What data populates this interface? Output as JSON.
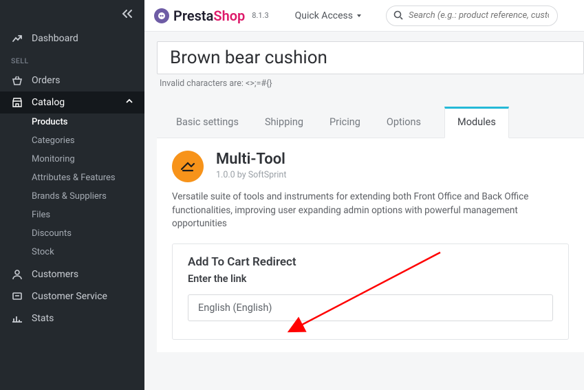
{
  "brand": {
    "name1": "Presta",
    "name2": "Shop",
    "version": "8.1.3"
  },
  "topbar": {
    "quick_access": "Quick Access",
    "search_placeholder": "Search (e.g.: product reference, custom"
  },
  "sidebar": {
    "section_sell": "SELL",
    "dashboard": "Dashboard",
    "orders": "Orders",
    "catalog": "Catalog",
    "catalog_items": {
      "products": "Products",
      "categories": "Categories",
      "monitoring": "Monitoring",
      "attributes": "Attributes & Features",
      "brands": "Brands & Suppliers",
      "files": "Files",
      "discounts": "Discounts",
      "stock": "Stock"
    },
    "customers": "Customers",
    "customer_service": "Customer Service",
    "stats": "Stats"
  },
  "product": {
    "title": "Brown bear cushion",
    "invalid_note": "Invalid characters are: <>;=#{}"
  },
  "tabs": {
    "basic": "Basic settings",
    "shipping": "Shipping",
    "pricing": "Pricing",
    "options": "Options",
    "modules": "Modules"
  },
  "module": {
    "name": "Multi-Tool",
    "meta": "1.0.0 by SoftSprint",
    "desc": "Versatile suite of tools and instruments for extending both Front Office and Back Office functionalities, improving user expanding admin options with powerful management opportunities",
    "card_title": "Add To Cart Redirect",
    "card_sub": "Enter the link",
    "lang_value": "English (English)"
  }
}
